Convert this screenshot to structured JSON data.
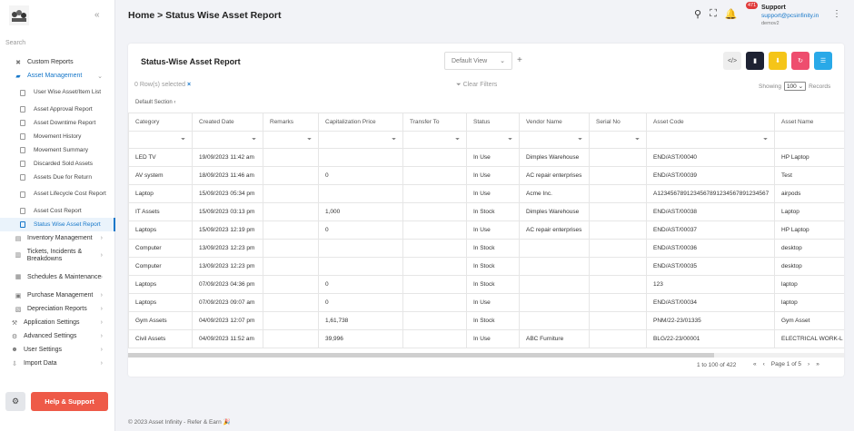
{
  "app": {
    "page_title": "Home > Status Wise Asset Report"
  },
  "sidebar": {
    "search_placeholder": "Search",
    "items_before": [
      {
        "label": "Custom Reports",
        "icon": "tools-icon"
      }
    ],
    "asset_management": {
      "label": "Asset Management",
      "children": [
        "User Wise Asset/Item List",
        "Asset Approval Report",
        "Asset Downtime Report",
        "Movement History",
        "Movement Summary",
        "Discarded Sold Assets",
        "Assets Due for Return",
        "Asset Lifecycle Cost Report",
        "Asset Cost Report",
        "Status Wise Asset Report"
      ],
      "active_child": "Status Wise Asset Report"
    },
    "items_after": [
      {
        "label": "Inventory Management"
      },
      {
        "label": "Tickets, Incidents & Breakdowns"
      },
      {
        "label": "Schedules & Maintenance"
      },
      {
        "label": "Purchase Management"
      },
      {
        "label": "Depreciation Reports"
      },
      {
        "label": "Application Settings"
      },
      {
        "label": "Advanced Settings"
      },
      {
        "label": "User Settings"
      },
      {
        "label": "Import Data"
      }
    ],
    "help_label": "Help & Support"
  },
  "header": {
    "notification_count": "471",
    "user_name": "Support",
    "user_email": "support@pcsinfinity.in",
    "user_org": "demov2"
  },
  "report": {
    "title": "Status-Wise Asset Report",
    "view_select": "Default View",
    "rows_selected": "0 Row(s) selected",
    "clear_filters": "Clear Filters",
    "showing_label": "Showing",
    "page_size": "100",
    "records_label": "Records",
    "section_label": "Default Section",
    "colors": {
      "code": "#eeeeee",
      "pdf": "#1e2233",
      "excel": "#f5c518",
      "refresh": "#ee4d6e",
      "columns": "#29a9e8"
    }
  },
  "table": {
    "columns": [
      "Category",
      "Created Date",
      "Remarks",
      "Capitalization Price",
      "Transfer To",
      "Status",
      "Vendor Name",
      "Serial No",
      "Asset Code",
      "Asset Name"
    ],
    "rows": [
      [
        "LED TV",
        "19/09/2023 11:42 am",
        "",
        "",
        "",
        "In Use",
        "Dimples Warehouse",
        "",
        "END/AST/00040",
        "HP Laptop"
      ],
      [
        "AV system",
        "18/09/2023 11:46 am",
        "",
        "0",
        "",
        "In Use",
        "AC repair enterprises",
        "",
        "END/AST/00039",
        "Test"
      ],
      [
        "Laptop",
        "15/09/2023 05:34 pm",
        "",
        "",
        "",
        "In Use",
        "Acme Inc.",
        "",
        "A1234567891234567891234567891234567",
        "airpods"
      ],
      [
        "IT Assets",
        "15/09/2023 03:13 pm",
        "",
        "1,000",
        "",
        "In Stock",
        "Dimples Warehouse",
        "",
        "END/AST/00038",
        "Laptop"
      ],
      [
        "Laptops",
        "15/09/2023 12:19 pm",
        "",
        "0",
        "",
        "In Use",
        "AC repair enterprises",
        "",
        "END/AST/00037",
        "HP Laptop"
      ],
      [
        "Computer",
        "13/09/2023 12:23 pm",
        "",
        "",
        "",
        "In Stock",
        "",
        "",
        "END/AST/00036",
        "desktop"
      ],
      [
        "Computer",
        "13/09/2023 12:23 pm",
        "",
        "",
        "",
        "In Stock",
        "",
        "",
        "END/AST/00035",
        "desktop"
      ],
      [
        "Laptops",
        "07/09/2023 04:36 pm",
        "",
        "0",
        "",
        "In Stock",
        "",
        "",
        "123",
        "laptop"
      ],
      [
        "Laptops",
        "07/09/2023 09:07 am",
        "",
        "0",
        "",
        "In Use",
        "",
        "",
        "END/AST/00034",
        "laptop"
      ],
      [
        "Gym Assets",
        "04/09/2023 12:07 pm",
        "",
        "1,61,738",
        "",
        "In Stock",
        "",
        "",
        "PNM/22-23/01335",
        "Gym Asset"
      ],
      [
        "Civil Assets",
        "04/09/2023 11:52 am",
        "",
        "39,996",
        "",
        "In Use",
        "ABC Furniture",
        "",
        "BLG/22-23/00001",
        "ELECTRICAL WORK-L"
      ]
    ]
  },
  "pager": {
    "range": "1 to 100 of 422",
    "page_text": "Page 1 of 5"
  },
  "footer": {
    "text": "© 2023 Asset Infinity - Refer & Earn 🎉"
  }
}
